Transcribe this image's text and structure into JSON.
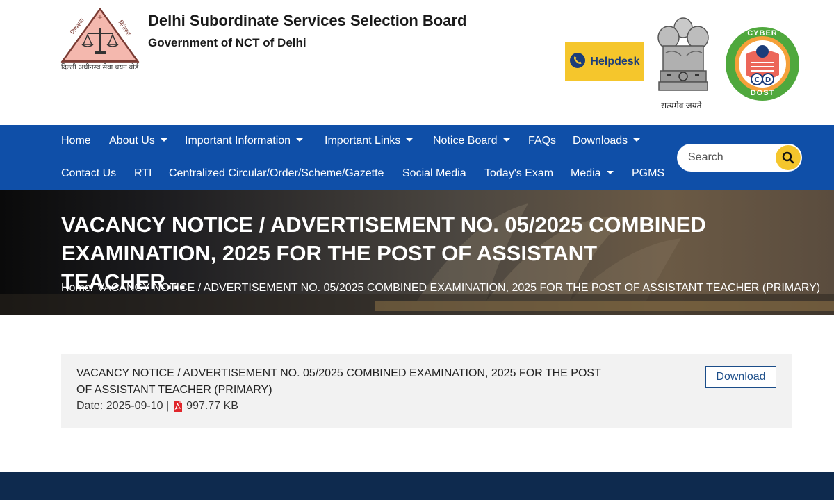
{
  "header": {
    "org_title": "Delhi Subordinate Services Selection Board",
    "org_subtitle": "Government of NCT of Delhi",
    "logo_caption": "दिल्ली अधीनस्थ सेवा चयन बोर्ड",
    "helpdesk_label": "Helpdesk",
    "emblem_caption": "सत्यमेव जयते",
    "cyber_top": "CYBER",
    "cyber_bottom": "DOST"
  },
  "nav": {
    "row1": [
      {
        "label": "Home"
      },
      {
        "label": "About Us"
      },
      {
        "label": "Important Information"
      },
      {
        "label": "Important Links"
      },
      {
        "label": "Notice Board"
      },
      {
        "label": "FAQs"
      },
      {
        "label": "Downloads"
      }
    ],
    "row2": [
      {
        "label": "Contact Us"
      },
      {
        "label": "RTI"
      },
      {
        "label": "Centralized Circular/Order/Scheme/Gazette"
      },
      {
        "label": "Social Media"
      },
      {
        "label": "Today's Exam"
      },
      {
        "label": "Media"
      },
      {
        "label": "PGMS"
      }
    ],
    "search_placeholder": "Search"
  },
  "hero": {
    "title": "VACANCY NOTICE / ADVERTISEMENT NO. 05/2025 COMBINED EXAMINATION, 2025 FOR THE POST OF ASSISTANT TEACHER…",
    "breadcrumb_home": "Home",
    "breadcrumb_current": "/ VACANCY NOTICE / ADVERTISEMENT NO. 05/2025 COMBINED EXAMINATION, 2025 FOR THE POST OF ASSISTANT TEACHER (PRIMARY)"
  },
  "notice": {
    "title": "VACANCY NOTICE / ADVERTISEMENT NO. 05/2025 COMBINED EXAMINATION, 2025 FOR THE POST OF ASSISTANT TEACHER (PRIMARY)",
    "date_text": "Date: 2025-09-10 |",
    "file_size": "997.77 KB",
    "file_icon": "pdf-icon",
    "download_label": "Download"
  },
  "colors": {
    "nav_bg": "#0f4fa8",
    "accent_yellow": "#f5c62c",
    "footer_bg": "#0e2a4e",
    "pdf_red": "#e0262b"
  }
}
